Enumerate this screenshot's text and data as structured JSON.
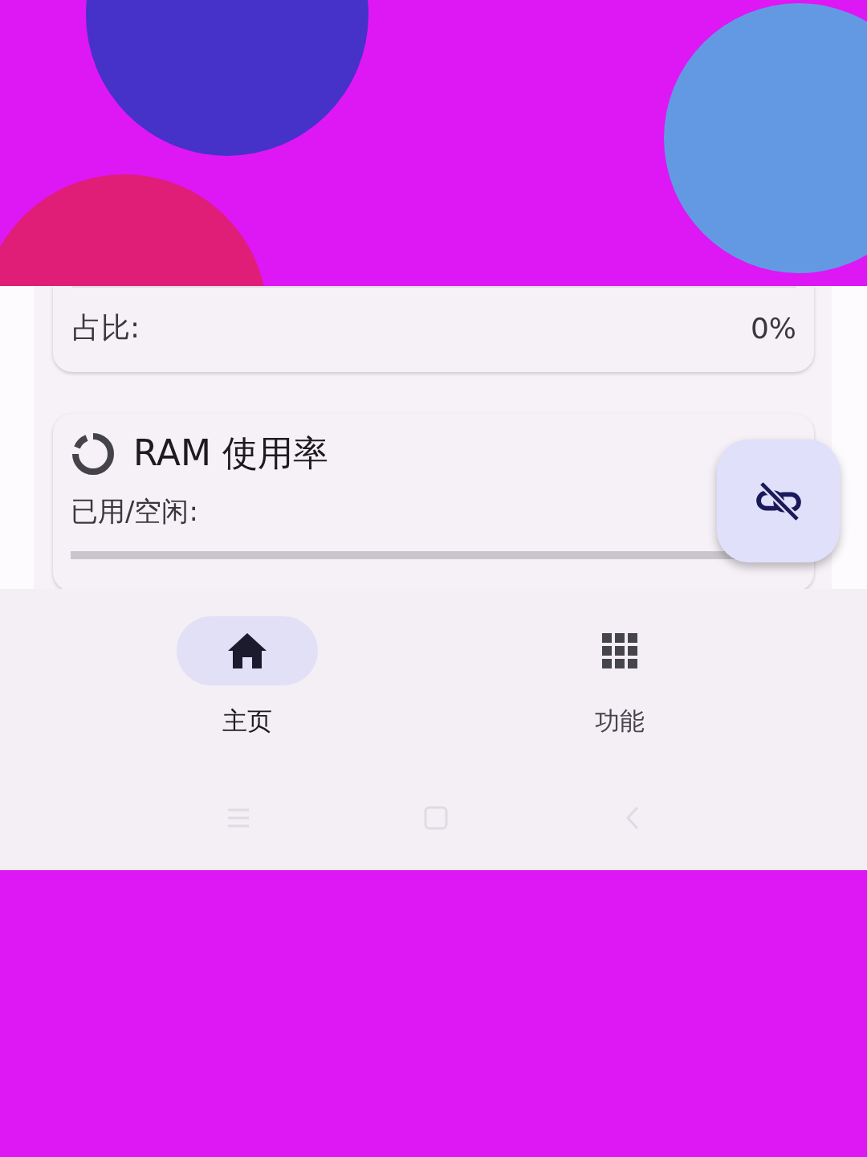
{
  "share_row": {
    "label": "占比:",
    "value": "0%"
  },
  "ram_card": {
    "title": "RAM 使用率",
    "used_label": "已用/空闲:"
  },
  "fab": {
    "kind": "unlink"
  },
  "bottom_nav": [
    {
      "label": "主页",
      "kind": "home",
      "selected": true
    },
    {
      "label": "功能",
      "kind": "apps",
      "selected": false
    }
  ]
}
